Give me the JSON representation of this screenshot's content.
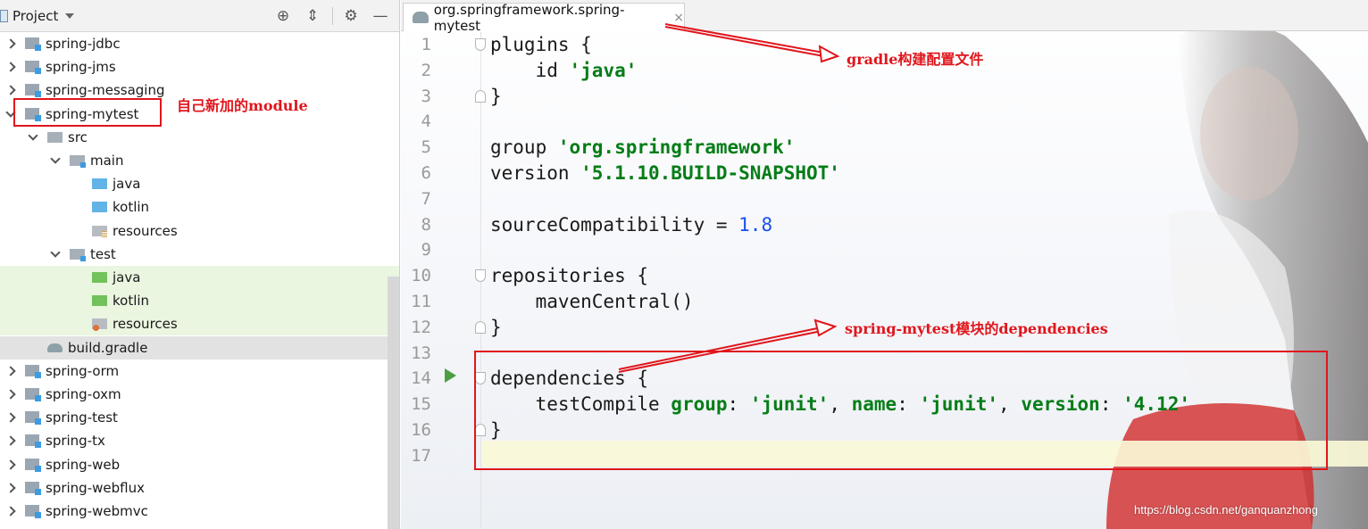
{
  "project_panel": {
    "title": "Project",
    "icons": [
      "target-icon",
      "collapse-icon",
      "gear-icon",
      "minimize-icon"
    ]
  },
  "tree": [
    {
      "label": "spring-jdbc",
      "arrow": "right",
      "indent": 0,
      "icon": "module",
      "bg": ""
    },
    {
      "label": "spring-jms",
      "arrow": "right",
      "indent": 0,
      "icon": "module",
      "bg": ""
    },
    {
      "label": "spring-messaging",
      "arrow": "right",
      "indent": 0,
      "icon": "module",
      "bg": ""
    },
    {
      "label": "spring-mytest",
      "arrow": "down",
      "indent": 0,
      "icon": "module",
      "bg": ""
    },
    {
      "label": "src",
      "arrow": "down",
      "indent": 1,
      "icon": "folder-grey",
      "bg": ""
    },
    {
      "label": "main",
      "arrow": "down",
      "indent": 2,
      "icon": "folder-grey-mod",
      "bg": ""
    },
    {
      "label": "java",
      "arrow": "none",
      "indent": 3,
      "icon": "folder-blue",
      "bg": ""
    },
    {
      "label": "kotlin",
      "arrow": "none",
      "indent": 3,
      "icon": "folder-blue",
      "bg": ""
    },
    {
      "label": "resources",
      "arrow": "none",
      "indent": 3,
      "icon": "folder-res",
      "bg": ""
    },
    {
      "label": "test",
      "arrow": "down",
      "indent": 2,
      "icon": "folder-grey-mod",
      "bg": ""
    },
    {
      "label": "java",
      "arrow": "none",
      "indent": 3,
      "icon": "folder-green",
      "bg": "test"
    },
    {
      "label": "kotlin",
      "arrow": "none",
      "indent": 3,
      "icon": "folder-green",
      "bg": "test"
    },
    {
      "label": "resources",
      "arrow": "none",
      "indent": 3,
      "icon": "folder-res-test",
      "bg": "test"
    },
    {
      "label": "build.gradle",
      "arrow": "none",
      "indent": 1,
      "icon": "gradle",
      "bg": "selected"
    },
    {
      "label": "spring-orm",
      "arrow": "right",
      "indent": 0,
      "icon": "module",
      "bg": ""
    },
    {
      "label": "spring-oxm",
      "arrow": "right",
      "indent": 0,
      "icon": "module",
      "bg": ""
    },
    {
      "label": "spring-test",
      "arrow": "right",
      "indent": 0,
      "icon": "module",
      "bg": ""
    },
    {
      "label": "spring-tx",
      "arrow": "right",
      "indent": 0,
      "icon": "module",
      "bg": ""
    },
    {
      "label": "spring-web",
      "arrow": "right",
      "indent": 0,
      "icon": "module",
      "bg": ""
    },
    {
      "label": "spring-webflux",
      "arrow": "right",
      "indent": 0,
      "icon": "module",
      "bg": ""
    },
    {
      "label": "spring-webmvc",
      "arrow": "right",
      "indent": 0,
      "icon": "module",
      "bg": ""
    }
  ],
  "editor": {
    "tab_label": "org.springframework.spring-mytest",
    "tab_close": "×",
    "line_numbers": [
      "1",
      "2",
      "3",
      "4",
      "5",
      "6",
      "7",
      "8",
      "9",
      "10",
      "11",
      "12",
      "13",
      "14",
      "15",
      "16",
      "17"
    ],
    "code_lines": [
      [
        {
          "t": "plugins {",
          "c": ""
        }
      ],
      [
        {
          "t": "    id ",
          "c": ""
        },
        {
          "t": "'java'",
          "c": "kw-str"
        }
      ],
      [
        {
          "t": "}",
          "c": ""
        }
      ],
      [],
      [
        {
          "t": "group ",
          "c": ""
        },
        {
          "t": "'org.springframework'",
          "c": "kw-str"
        }
      ],
      [
        {
          "t": "version ",
          "c": ""
        },
        {
          "t": "'5.1.10.BUILD-SNAPSHOT'",
          "c": "kw-str"
        }
      ],
      [],
      [
        {
          "t": "sourceCompatibility = ",
          "c": ""
        },
        {
          "t": "1.8",
          "c": "num"
        }
      ],
      [],
      [
        {
          "t": "repositories {",
          "c": ""
        }
      ],
      [
        {
          "t": "    mavenCentral()",
          "c": ""
        }
      ],
      [
        {
          "t": "}",
          "c": ""
        }
      ],
      [],
      [
        {
          "t": "dependencies {",
          "c": ""
        }
      ],
      [
        {
          "t": "    testCompile ",
          "c": ""
        },
        {
          "t": "group",
          "c": "kw-named"
        },
        {
          "t": ": ",
          "c": ""
        },
        {
          "t": "'junit'",
          "c": "kw-str"
        },
        {
          "t": ", ",
          "c": ""
        },
        {
          "t": "name",
          "c": "kw-named"
        },
        {
          "t": ": ",
          "c": ""
        },
        {
          "t": "'junit'",
          "c": "kw-str"
        },
        {
          "t": ", ",
          "c": ""
        },
        {
          "t": "version",
          "c": "kw-named"
        },
        {
          "t": ": ",
          "c": ""
        },
        {
          "t": "'4.12'",
          "c": "kw-str"
        }
      ],
      [
        {
          "t": "}",
          "c": ""
        }
      ],
      []
    ]
  },
  "annotations": {
    "new_module": "自己新加的module",
    "gradle_config": "gradle构建配置文件",
    "dependencies": "spring-mytest模块的dependencies"
  },
  "watermark": "https://blog.csdn.net/ganquanzhong",
  "colors": {
    "annotation_red": "#e0161c",
    "string_green": "#067d17",
    "number_blue": "#1750eb"
  }
}
